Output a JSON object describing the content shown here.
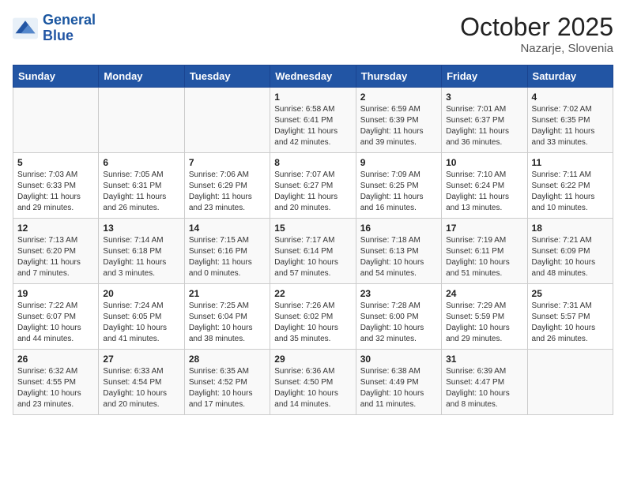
{
  "header": {
    "logo_line1": "General",
    "logo_line2": "Blue",
    "month": "October 2025",
    "location": "Nazarje, Slovenia"
  },
  "weekdays": [
    "Sunday",
    "Monday",
    "Tuesday",
    "Wednesday",
    "Thursday",
    "Friday",
    "Saturday"
  ],
  "weeks": [
    [
      {
        "day": "",
        "info": ""
      },
      {
        "day": "",
        "info": ""
      },
      {
        "day": "",
        "info": ""
      },
      {
        "day": "1",
        "info": "Sunrise: 6:58 AM\nSunset: 6:41 PM\nDaylight: 11 hours\nand 42 minutes."
      },
      {
        "day": "2",
        "info": "Sunrise: 6:59 AM\nSunset: 6:39 PM\nDaylight: 11 hours\nand 39 minutes."
      },
      {
        "day": "3",
        "info": "Sunrise: 7:01 AM\nSunset: 6:37 PM\nDaylight: 11 hours\nand 36 minutes."
      },
      {
        "day": "4",
        "info": "Sunrise: 7:02 AM\nSunset: 6:35 PM\nDaylight: 11 hours\nand 33 minutes."
      }
    ],
    [
      {
        "day": "5",
        "info": "Sunrise: 7:03 AM\nSunset: 6:33 PM\nDaylight: 11 hours\nand 29 minutes."
      },
      {
        "day": "6",
        "info": "Sunrise: 7:05 AM\nSunset: 6:31 PM\nDaylight: 11 hours\nand 26 minutes."
      },
      {
        "day": "7",
        "info": "Sunrise: 7:06 AM\nSunset: 6:29 PM\nDaylight: 11 hours\nand 23 minutes."
      },
      {
        "day": "8",
        "info": "Sunrise: 7:07 AM\nSunset: 6:27 PM\nDaylight: 11 hours\nand 20 minutes."
      },
      {
        "day": "9",
        "info": "Sunrise: 7:09 AM\nSunset: 6:25 PM\nDaylight: 11 hours\nand 16 minutes."
      },
      {
        "day": "10",
        "info": "Sunrise: 7:10 AM\nSunset: 6:24 PM\nDaylight: 11 hours\nand 13 minutes."
      },
      {
        "day": "11",
        "info": "Sunrise: 7:11 AM\nSunset: 6:22 PM\nDaylight: 11 hours\nand 10 minutes."
      }
    ],
    [
      {
        "day": "12",
        "info": "Sunrise: 7:13 AM\nSunset: 6:20 PM\nDaylight: 11 hours\nand 7 minutes."
      },
      {
        "day": "13",
        "info": "Sunrise: 7:14 AM\nSunset: 6:18 PM\nDaylight: 11 hours\nand 3 minutes."
      },
      {
        "day": "14",
        "info": "Sunrise: 7:15 AM\nSunset: 6:16 PM\nDaylight: 11 hours\nand 0 minutes."
      },
      {
        "day": "15",
        "info": "Sunrise: 7:17 AM\nSunset: 6:14 PM\nDaylight: 10 hours\nand 57 minutes."
      },
      {
        "day": "16",
        "info": "Sunrise: 7:18 AM\nSunset: 6:13 PM\nDaylight: 10 hours\nand 54 minutes."
      },
      {
        "day": "17",
        "info": "Sunrise: 7:19 AM\nSunset: 6:11 PM\nDaylight: 10 hours\nand 51 minutes."
      },
      {
        "day": "18",
        "info": "Sunrise: 7:21 AM\nSunset: 6:09 PM\nDaylight: 10 hours\nand 48 minutes."
      }
    ],
    [
      {
        "day": "19",
        "info": "Sunrise: 7:22 AM\nSunset: 6:07 PM\nDaylight: 10 hours\nand 44 minutes."
      },
      {
        "day": "20",
        "info": "Sunrise: 7:24 AM\nSunset: 6:05 PM\nDaylight: 10 hours\nand 41 minutes."
      },
      {
        "day": "21",
        "info": "Sunrise: 7:25 AM\nSunset: 6:04 PM\nDaylight: 10 hours\nand 38 minutes."
      },
      {
        "day": "22",
        "info": "Sunrise: 7:26 AM\nSunset: 6:02 PM\nDaylight: 10 hours\nand 35 minutes."
      },
      {
        "day": "23",
        "info": "Sunrise: 7:28 AM\nSunset: 6:00 PM\nDaylight: 10 hours\nand 32 minutes."
      },
      {
        "day": "24",
        "info": "Sunrise: 7:29 AM\nSunset: 5:59 PM\nDaylight: 10 hours\nand 29 minutes."
      },
      {
        "day": "25",
        "info": "Sunrise: 7:31 AM\nSunset: 5:57 PM\nDaylight: 10 hours\nand 26 minutes."
      }
    ],
    [
      {
        "day": "26",
        "info": "Sunrise: 6:32 AM\nSunset: 4:55 PM\nDaylight: 10 hours\nand 23 minutes."
      },
      {
        "day": "27",
        "info": "Sunrise: 6:33 AM\nSunset: 4:54 PM\nDaylight: 10 hours\nand 20 minutes."
      },
      {
        "day": "28",
        "info": "Sunrise: 6:35 AM\nSunset: 4:52 PM\nDaylight: 10 hours\nand 17 minutes."
      },
      {
        "day": "29",
        "info": "Sunrise: 6:36 AM\nSunset: 4:50 PM\nDaylight: 10 hours\nand 14 minutes."
      },
      {
        "day": "30",
        "info": "Sunrise: 6:38 AM\nSunset: 4:49 PM\nDaylight: 10 hours\nand 11 minutes."
      },
      {
        "day": "31",
        "info": "Sunrise: 6:39 AM\nSunset: 4:47 PM\nDaylight: 10 hours\nand 8 minutes."
      },
      {
        "day": "",
        "info": ""
      }
    ]
  ]
}
